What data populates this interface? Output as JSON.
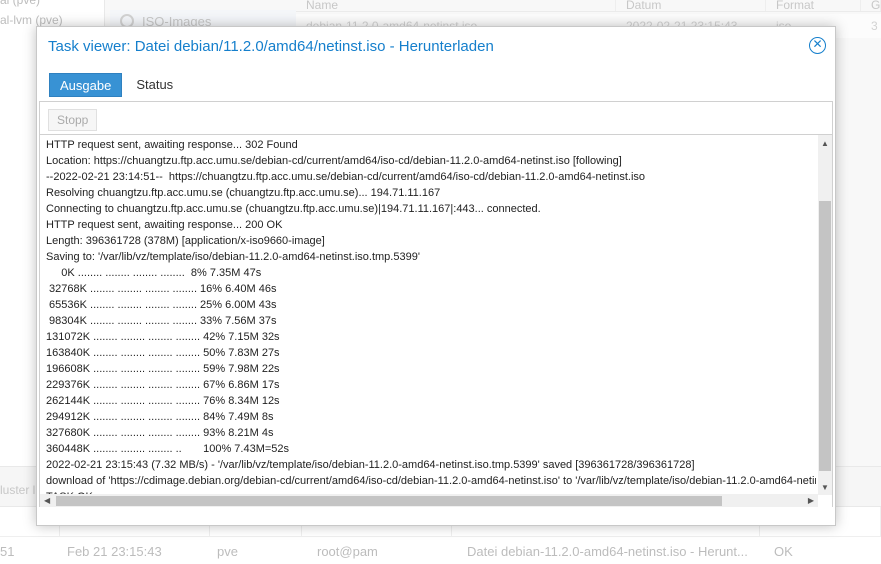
{
  "background": {
    "tree": [
      "al (pve)",
      "al-lvm (pve)"
    ],
    "storage_item": "ISO-Images",
    "grid_headers": [
      "Name",
      "Datum",
      "Format",
      "G"
    ],
    "grid_row": [
      "debian-11.2.0-amd64-netinst.iso",
      "2022-02-21 23:15:43",
      "iso",
      "3"
    ],
    "bottom_tab": "luster l",
    "log_row": {
      "id": "51",
      "start": "Feb 21 23:15:43",
      "node": "pve",
      "user": "root@pam",
      "description": "Datei debian-11.2.0-amd64-netinst.iso - Herunt...",
      "status": "OK"
    }
  },
  "modal": {
    "title": "Task viewer: Datei debian/11.2.0/amd64/netinst.iso - Herunterladen",
    "tabs": [
      {
        "label": "Ausgabe",
        "active": true
      },
      {
        "label": "Status",
        "active": false
      }
    ],
    "stop_label": "Stopp",
    "log_lines": [
      "HTTP request sent, awaiting response... 302 Found",
      "Location: https://chuangtzu.ftp.acc.umu.se/debian-cd/current/amd64/iso-cd/debian-11.2.0-amd64-netinst.iso [following]",
      "--2022-02-21 23:14:51--  https://chuangtzu.ftp.acc.umu.se/debian-cd/current/amd64/iso-cd/debian-11.2.0-amd64-netinst.iso",
      "Resolving chuangtzu.ftp.acc.umu.se (chuangtzu.ftp.acc.umu.se)... 194.71.11.167",
      "Connecting to chuangtzu.ftp.acc.umu.se (chuangtzu.ftp.acc.umu.se)|194.71.11.167|:443... connected.",
      "HTTP request sent, awaiting response... 200 OK",
      "Length: 396361728 (378M) [application/x-iso9660-image]",
      "Saving to: '/var/lib/vz/template/iso/debian-11.2.0-amd64-netinst.iso.tmp.5399'",
      "     0K ........ ........ ........ ........  8% 7.35M 47s",
      " 32768K ........ ........ ........ ........ 16% 6.40M 46s",
      " 65536K ........ ........ ........ ........ 25% 6.00M 43s",
      " 98304K ........ ........ ........ ........ 33% 7.56M 37s",
      "131072K ........ ........ ........ ........ 42% 7.15M 32s",
      "163840K ........ ........ ........ ........ 50% 7.83M 27s",
      "196608K ........ ........ ........ ........ 59% 7.98M 22s",
      "229376K ........ ........ ........ ........ 67% 6.86M 17s",
      "262144K ........ ........ ........ ........ 76% 8.34M 12s",
      "294912K ........ ........ ........ ........ 84% 7.49M 8s",
      "327680K ........ ........ ........ ........ 93% 8.21M 4s",
      "360448K ........ ........ ........ ..       100% 7.43M=52s",
      "2022-02-21 23:15:43 (7.32 MB/s) - '/var/lib/vz/template/iso/debian-11.2.0-amd64-netinst.iso.tmp.5399' saved [396361728/396361728]",
      "download of 'https://cdimage.debian.org/debian-cd/current/amd64/iso-cd/debian-11.2.0-amd64-netinst.iso' to '/var/lib/vz/template/iso/debian-11.2.0-amd64-netinst.iso' finished",
      "TASK OK"
    ]
  },
  "colors": {
    "accent": "#157fcc",
    "active_tab": "#3892d4"
  }
}
